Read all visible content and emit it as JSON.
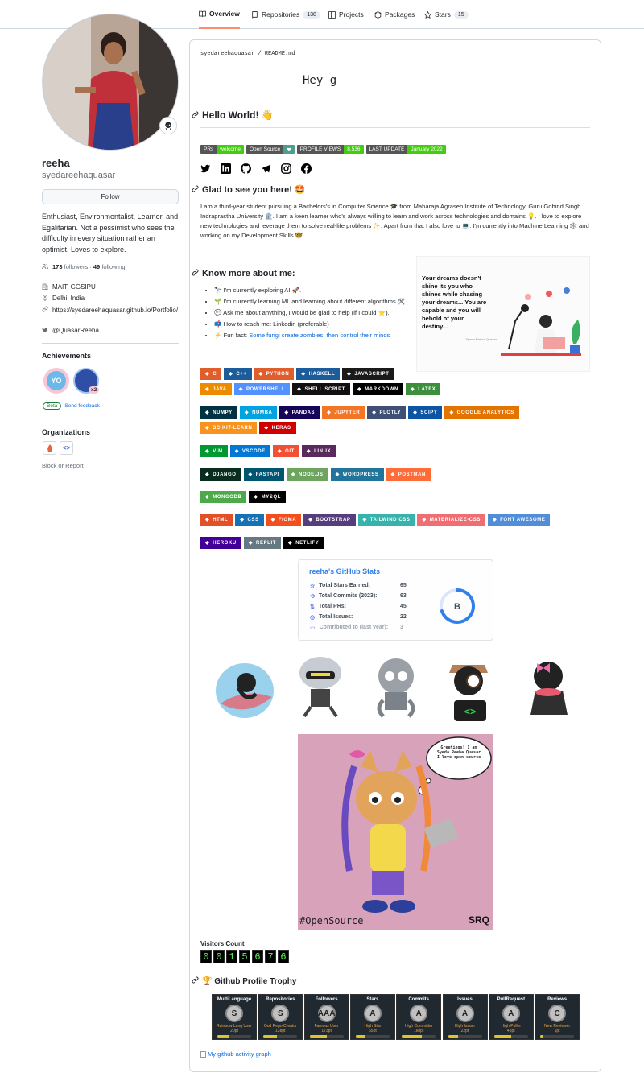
{
  "nav": {
    "tabs": [
      {
        "label": "Overview",
        "count": ""
      },
      {
        "label": "Repositories",
        "count": "138"
      },
      {
        "label": "Projects",
        "count": ""
      },
      {
        "label": "Packages",
        "count": ""
      },
      {
        "label": "Stars",
        "count": "15"
      }
    ]
  },
  "profile": {
    "name": "reeha",
    "login": "syedareehaquasar",
    "follow_label": "Follow",
    "bio": "Enthusiast, Environmentalist, Learner, and Egalitarian. Not a pessimist who sees the difficulty in every situation rather an optimist. Loves to explore.",
    "followers": "173",
    "followers_label": "followers",
    "following": "49",
    "following_label": "following",
    "org": "MAIT, GGSIPU",
    "location": "Delhi, India",
    "website": "https://syedareehaquasar.github.io/Portfolio/",
    "twitter": "@QuasarReeha",
    "achievements_title": "Achievements",
    "achievement_multiplier": "x2",
    "beta_label": "Beta",
    "feedback_label": "Send feedback",
    "organizations_title": "Organizations",
    "block_label": "Block or Report"
  },
  "readme": {
    "crumb_user": "syedareehaquasar",
    "crumb_sep": "/",
    "crumb_file": "README.md",
    "greeting": "Hey g",
    "hello": "Hello World! 👋",
    "shields": [
      {
        "label": "PRs",
        "value": "welcome",
        "lc": "#555",
        "vc": "#4c1"
      },
      {
        "label": "Open Source",
        "value": "❤",
        "lc": "#555",
        "vc": "#4c9f8f"
      },
      {
        "label": "PROFILE VIEWS",
        "value": "8,536",
        "lc": "#555",
        "vc": "#4c1"
      },
      {
        "label": "LAST UPDATE",
        "value": "January 2022",
        "lc": "#555",
        "vc": "#4c1"
      }
    ],
    "glad": "Glad to see you here! 🤩",
    "intro": "I am a third-year student pursuing a Bachelors's in Computer Science 🎓 from Maharaja Agrasen Institute of Technology, Guru Gobind Singh Indraprastha University 🏛️. I am a keen learner who's always willing to learn and work across technologies and domains 💡. I love to explore new technologies and leverage them to solve real-life problems ✨. Apart from that I also love to 💻. I'm currently into Machine Learning 🕸️ and working on my Development Skills 🤓.",
    "know_more": "Know more about me:",
    "bullets": [
      "🔭 I'm currently exploring AI 🚀.",
      "🌱 I'm currently learning ML and learning about different algorithms 🛠️.",
      "💬 Ask me about anything, I would be glad to help (if I could ⭐).",
      "📫 How to reach me: Linkedin (preferable)"
    ],
    "fun_prefix": "⚡ Fun fact: ",
    "fun_link": "Some fungi create zombies, then control their minds",
    "quote": "Your dreams doesn't shine its you who shines while chasing your dreams... You are capable and you will behold of your destiny...",
    "quote_by": "- Syeda Reeha Quasar",
    "visitors_title": "Visitors Count",
    "visitor_digits": [
      "0",
      "0",
      "1",
      "5",
      "6",
      "7",
      "6"
    ],
    "trophy_title": "🏆 Github Profile Trophy",
    "activity_alt": "My github activity graph",
    "cat_caption": "#OpenSource",
    "cat_sig": "SRQ",
    "cat_bubble": "Greetings! I am Syeda Reeha Quasar I love open source"
  },
  "badges": [
    [
      {
        "t": "C",
        "c": "#e05d2c"
      },
      {
        "t": "C++",
        "c": "#1d5c9b"
      },
      {
        "t": "PYTHON",
        "c": "#e05d2c"
      },
      {
        "t": "HASKELL",
        "c": "#1d5c9b"
      },
      {
        "t": "JAVASCRIPT",
        "c": "#1a1a1a"
      }
    ],
    [
      {
        "t": "JAVA",
        "c": "#ed8b00"
      },
      {
        "t": "POWERSHELL",
        "c": "#5391fe"
      },
      {
        "t": "SHELL SCRIPT",
        "c": "#121011"
      },
      {
        "t": "MARKDOWN",
        "c": "#000"
      },
      {
        "t": "LATEX",
        "c": "#3d8f3d"
      }
    ],
    [
      {
        "t": "NUMPY",
        "c": "#013243"
      },
      {
        "t": "NUMBA",
        "c": "#00a3e0"
      },
      {
        "t": "PANDAS",
        "c": "#150458"
      },
      {
        "t": "JUPYTER",
        "c": "#f37626"
      },
      {
        "t": "PLOTLY",
        "c": "#3f4f75"
      },
      {
        "t": "SCIPY",
        "c": "#0c55a5"
      },
      {
        "t": "GOOGLE ANALYTICS",
        "c": "#e37400"
      }
    ],
    [
      {
        "t": "SCIKIT-LEARN",
        "c": "#f7931e"
      },
      {
        "t": "KERAS",
        "c": "#d00000"
      }
    ],
    [
      {
        "t": "VIM",
        "c": "#019733"
      },
      {
        "t": "VSCODE",
        "c": "#0078d4"
      },
      {
        "t": "GIT",
        "c": "#f05033"
      },
      {
        "t": "LINUX",
        "c": "#5a2a5e"
      }
    ],
    [
      {
        "t": "DJANGO",
        "c": "#092e20"
      },
      {
        "t": "FASTAPI",
        "c": "#005571"
      },
      {
        "t": "NODE.JS",
        "c": "#6da55f"
      },
      {
        "t": "WORDPRESS",
        "c": "#21759b"
      },
      {
        "t": "POSTMAN",
        "c": "#ff6c37"
      }
    ],
    [
      {
        "t": "MONGODB",
        "c": "#4ea94b"
      },
      {
        "t": "MYSQL",
        "c": "#000"
      }
    ],
    [
      {
        "t": "HTML",
        "c": "#e34f26"
      },
      {
        "t": "CSS",
        "c": "#1572b6"
      },
      {
        "t": "FIGMA",
        "c": "#f24e1e"
      },
      {
        "t": "BOOTSTRAP",
        "c": "#563d7c"
      },
      {
        "t": "TAILWIND CSS",
        "c": "#38b2ac"
      },
      {
        "t": "MATERIALIZE-CSS",
        "c": "#ee6e73"
      },
      {
        "t": "FONT AWESOME",
        "c": "#528dd7"
      }
    ],
    [
      {
        "t": "HEROKU",
        "c": "#430098"
      },
      {
        "t": "REPLIT",
        "c": "#667881"
      },
      {
        "t": "NETLIFY",
        "c": "#000"
      }
    ]
  ],
  "stats": {
    "title": "reeha's GitHub Stats",
    "rows": [
      {
        "label": "Total Stars Earned:",
        "value": "65"
      },
      {
        "label": "Total Commits (2023):",
        "value": "63"
      },
      {
        "label": "Total PRs:",
        "value": "45"
      },
      {
        "label": "Total Issues:",
        "value": "22"
      },
      {
        "label": "Contributed to (last year):",
        "value": "3"
      }
    ],
    "grade": "B",
    "grade_progress": 0.7
  },
  "trophies": [
    {
      "title": "MultiLanguage",
      "rank": "S",
      "sub": "Rainbow Lang User",
      "pt": "20pt",
      "progress": 0.35
    },
    {
      "title": "Repositories",
      "rank": "S",
      "sub": "God Repo Creator",
      "pt": "138pt",
      "progress": 0.4
    },
    {
      "title": "Followers",
      "rank": "AAA",
      "sub": "Famous User",
      "pt": "173pt",
      "progress": 0.5
    },
    {
      "title": "Stars",
      "rank": "A",
      "sub": "High Star",
      "pt": "65pt",
      "progress": 0.3
    },
    {
      "title": "Commits",
      "rank": "A",
      "sub": "High Committer",
      "pt": "1k8pt",
      "progress": 0.6
    },
    {
      "title": "Issues",
      "rank": "A",
      "sub": "High Issuer",
      "pt": "22pt",
      "progress": 0.3
    },
    {
      "title": "PullRequest",
      "rank": "A",
      "sub": "High Puller",
      "pt": "45pt",
      "progress": 0.5
    },
    {
      "title": "Reviews",
      "rank": "C",
      "sub": "New Reviewer",
      "pt": "1pt",
      "progress": 0.1
    }
  ]
}
